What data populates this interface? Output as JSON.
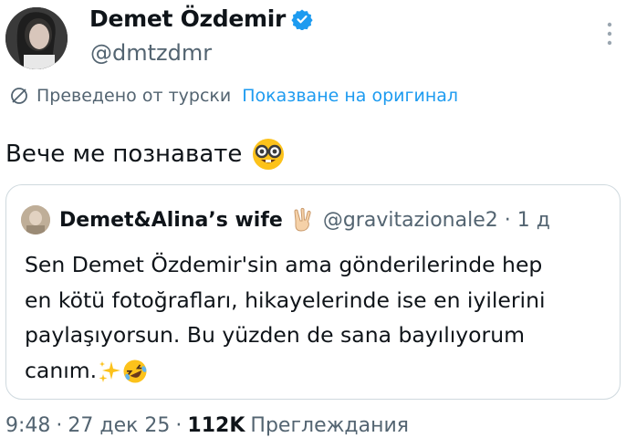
{
  "author": {
    "name": "Demet Özdemir",
    "handle": "@dmtzdmr",
    "verified": true
  },
  "translation": {
    "label": "Преведено от турски",
    "show_original": "Показване на оригинал"
  },
  "tweet": {
    "text": "Вече ме познавате",
    "emoji_icon": "nerd-face-icon"
  },
  "quote": {
    "author_name": "Demet&Alina’s wife",
    "hand_icon": "victory-hand-icon",
    "handle": "@gravitazionale2",
    "time": "1 д",
    "text": "Sen Demet Özdemir'sin ama gönderilerinde hep\nen kötü fotoğrafları, hikayelerinde ise en iyilerini\npaylaşıyorsun. Bu yüzden de sana bayılıyorum\ncanım.",
    "trailing_icons": [
      "sparkles-icon",
      "rolling-laughing-icon"
    ]
  },
  "footer": {
    "time": "9:48",
    "date": "27 дек 25",
    "views_count": "112K",
    "views_label": "Преглеждания"
  },
  "colors": {
    "link": "#1d9bf0",
    "muted": "#536471",
    "text": "#0f1419",
    "border": "#cfd9de"
  }
}
